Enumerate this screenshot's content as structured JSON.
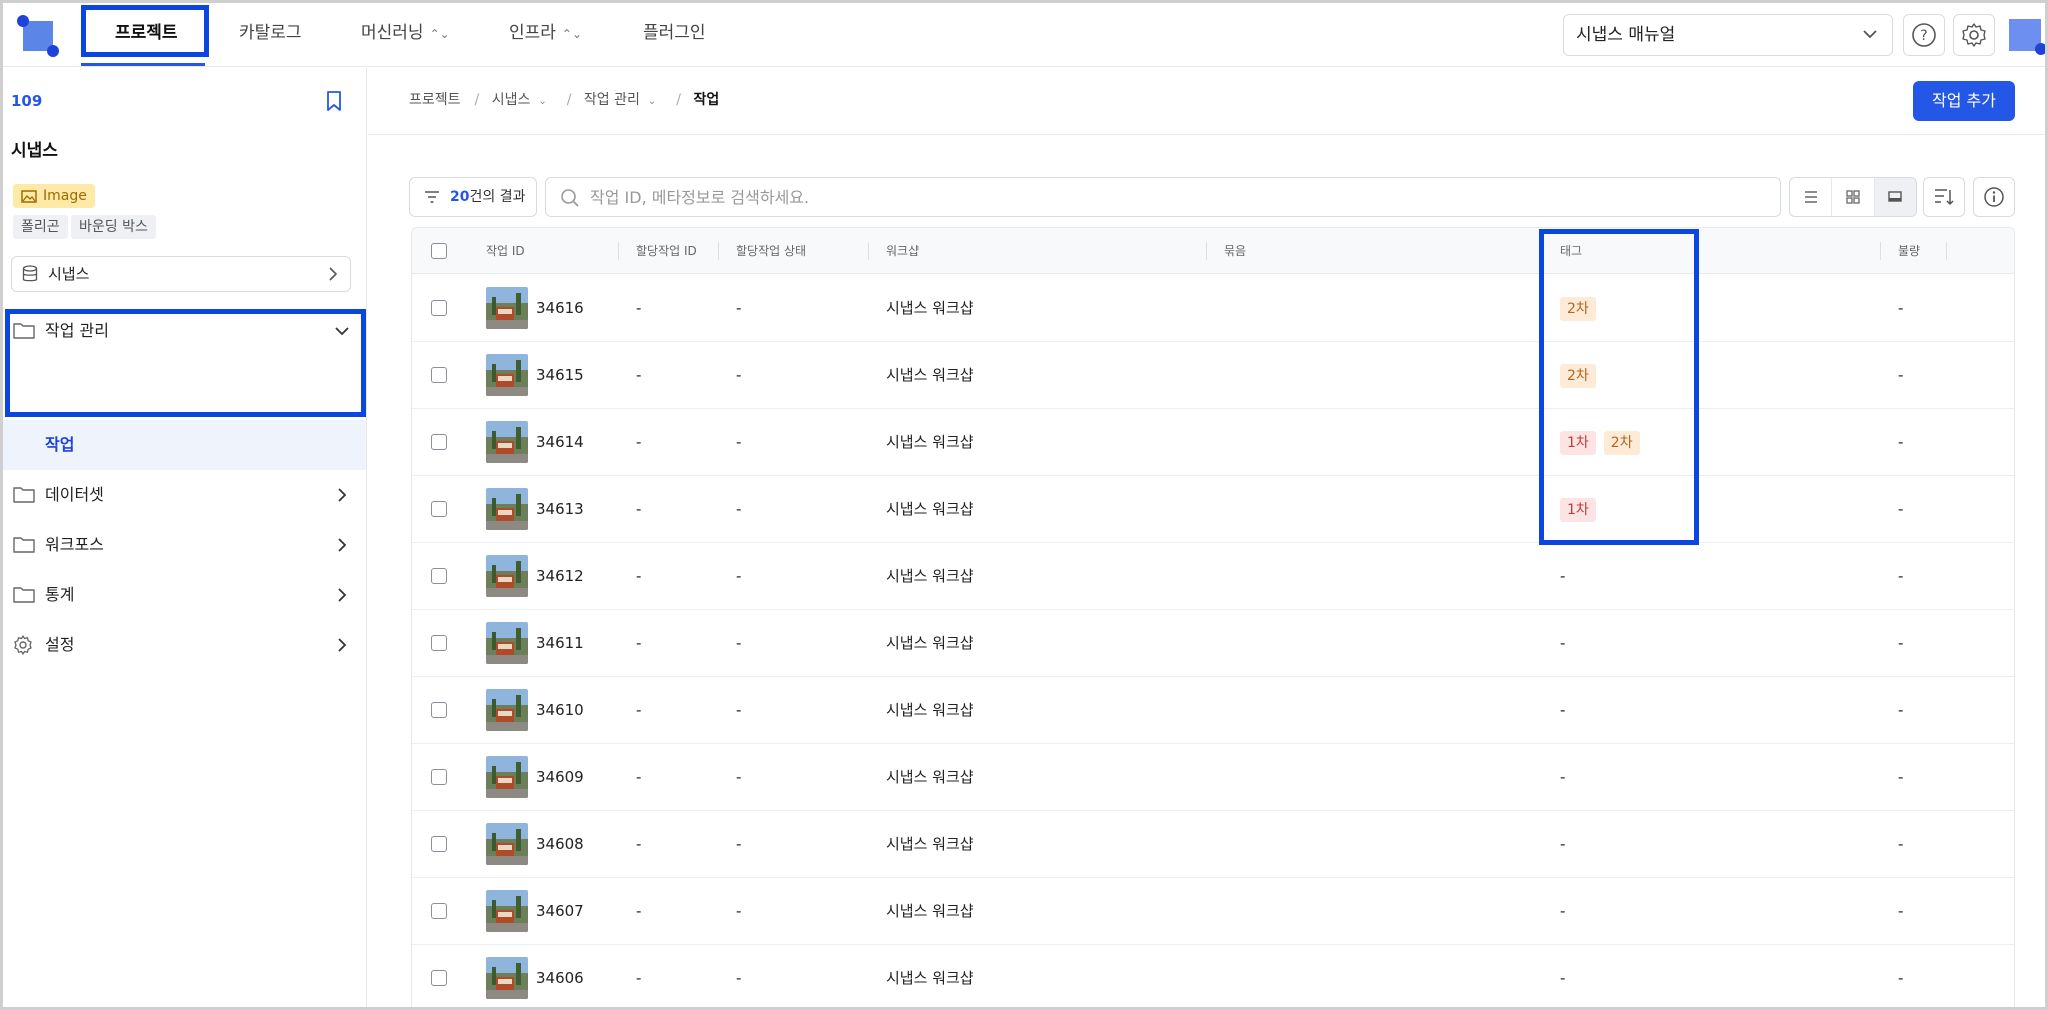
{
  "topnav": {
    "items": [
      {
        "label": "프로젝트",
        "active": true,
        "dropdown": false
      },
      {
        "label": "카탈로그",
        "active": false,
        "dropdown": false
      },
      {
        "label": "머신러닝",
        "active": false,
        "dropdown": true
      },
      {
        "label": "인프라",
        "active": false,
        "dropdown": true
      },
      {
        "label": "플러그인",
        "active": false,
        "dropdown": false
      }
    ],
    "manual_select": "시냅스 매뉴얼",
    "icons": [
      "help-circle-icon",
      "settings-gear-icon",
      "avatar"
    ]
  },
  "sidebar": {
    "project_id": "109",
    "project_name": "시냅스",
    "type_badge": "Image",
    "annotation_tags": [
      "폴리곤",
      "바운딩 박스"
    ],
    "dataset_select": "시냅스",
    "menu": [
      {
        "label": "작업 관리",
        "icon": "folder-icon",
        "expanded": true
      },
      {
        "label": "데이터셋",
        "icon": "folder-icon",
        "expanded": false
      },
      {
        "label": "워크포스",
        "icon": "folder-icon",
        "expanded": false
      },
      {
        "label": "통계",
        "icon": "folder-icon",
        "expanded": false
      },
      {
        "label": "설정",
        "icon": "gear-icon",
        "expanded": false
      }
    ],
    "submenu_active": "작업"
  },
  "breadcrumb": [
    "프로젝트",
    "시냅스",
    "작업 관리",
    "작업"
  ],
  "add_button": "작업 추가",
  "toolbar": {
    "result_count": "20",
    "result_suffix": "건의 결과",
    "search_placeholder": "작업 ID, 메타정보로 검색하세요."
  },
  "table": {
    "headers": [
      "작업 ID",
      "할당작업 ID",
      "할당작업 상태",
      "워크샵",
      "묶음",
      "태그",
      "불량"
    ],
    "rows": [
      {
        "id": "34616",
        "assign_id": "-",
        "assign_status": "-",
        "workshop": "시냅스 워크샵",
        "bundle": "",
        "tags": [
          "2차"
        ],
        "defect": "-"
      },
      {
        "id": "34615",
        "assign_id": "-",
        "assign_status": "-",
        "workshop": "시냅스 워크샵",
        "bundle": "",
        "tags": [
          "2차"
        ],
        "defect": "-"
      },
      {
        "id": "34614",
        "assign_id": "-",
        "assign_status": "-",
        "workshop": "시냅스 워크샵",
        "bundle": "",
        "tags": [
          "1차",
          "2차"
        ],
        "defect": "-"
      },
      {
        "id": "34613",
        "assign_id": "-",
        "assign_status": "-",
        "workshop": "시냅스 워크샵",
        "bundle": "",
        "tags": [
          "1차"
        ],
        "defect": "-"
      },
      {
        "id": "34612",
        "assign_id": "-",
        "assign_status": "-",
        "workshop": "시냅스 워크샵",
        "bundle": "",
        "tags": [],
        "tag_text": "-",
        "defect": "-"
      },
      {
        "id": "34611",
        "assign_id": "-",
        "assign_status": "-",
        "workshop": "시냅스 워크샵",
        "bundle": "",
        "tags": [],
        "tag_text": "-",
        "defect": "-"
      },
      {
        "id": "34610",
        "assign_id": "-",
        "assign_status": "-",
        "workshop": "시냅스 워크샵",
        "bundle": "",
        "tags": [],
        "tag_text": "-",
        "defect": "-"
      },
      {
        "id": "34609",
        "assign_id": "-",
        "assign_status": "-",
        "workshop": "시냅스 워크샵",
        "bundle": "",
        "tags": [],
        "tag_text": "-",
        "defect": "-"
      },
      {
        "id": "34608",
        "assign_id": "-",
        "assign_status": "-",
        "workshop": "시냅스 워크샵",
        "bundle": "",
        "tags": [],
        "tag_text": "-",
        "defect": "-"
      },
      {
        "id": "34607",
        "assign_id": "-",
        "assign_status": "-",
        "workshop": "시냅스 워크샵",
        "bundle": "",
        "tags": [],
        "tag_text": "-",
        "defect": "-"
      },
      {
        "id": "34606",
        "assign_id": "-",
        "assign_status": "-",
        "workshop": "시냅스 워크샵",
        "bundle": "",
        "tags": [],
        "tag_text": "-",
        "defect": "-"
      }
    ]
  },
  "colors": {
    "accent": "#2557e6",
    "highlight_box": "#0b46e0",
    "tag_2nd_bg": "#fdebd8",
    "tag_1st_bg": "#fde4e4",
    "image_badge_bg": "#fde9a8"
  }
}
